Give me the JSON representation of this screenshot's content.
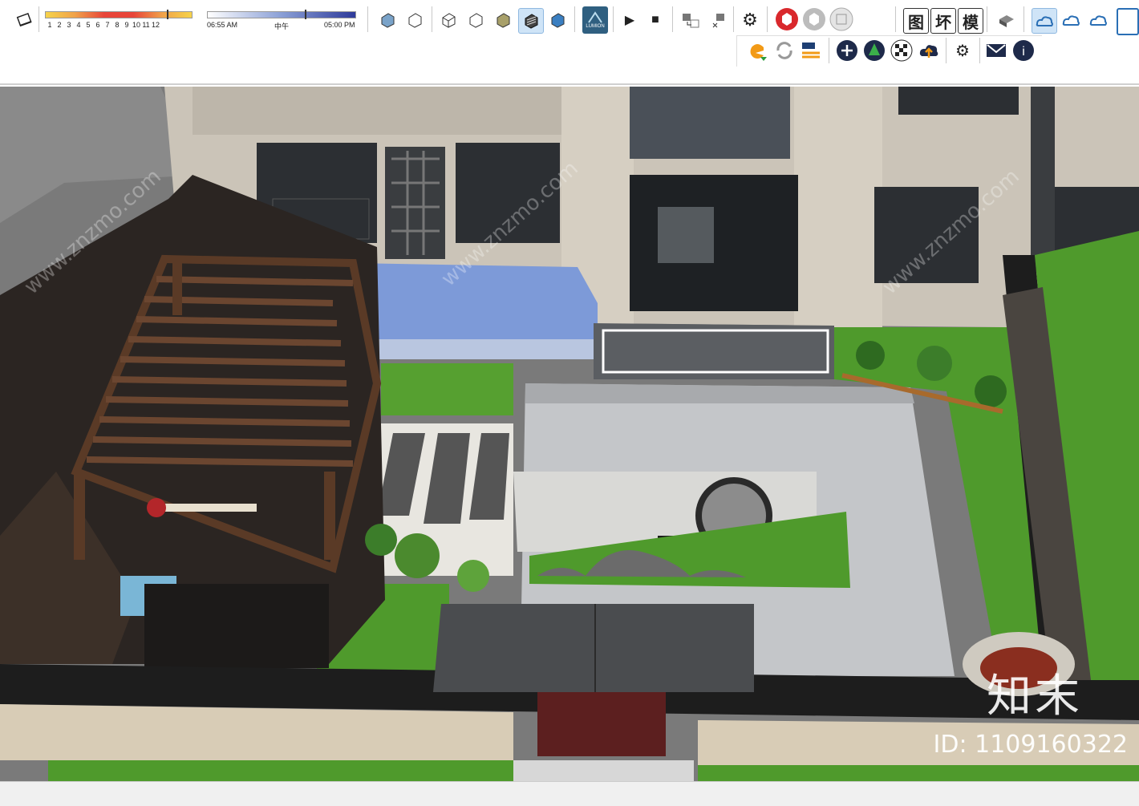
{
  "toolbar": {
    "shadow_months": [
      "1",
      "2",
      "3",
      "4",
      "5",
      "6",
      "7",
      "8",
      "9",
      "10",
      "11",
      "12"
    ],
    "time_start": "06:55 AM",
    "time_mid": "中午",
    "time_end": "05:00 PM",
    "lumion_label": "LUMION",
    "chinese_buttons": [
      "图",
      "坏",
      "模"
    ]
  },
  "watermark": {
    "logo": "知末",
    "id_text": "ID: 1109160322",
    "site": "www.znzmo.com"
  },
  "colors": {
    "sky": "#7d7d7d",
    "grass": "#4f9a2c",
    "paving": "#c4c6c9",
    "pergola": "#5a3a26",
    "building": "#c9c2b6",
    "wall_black": "#1d1d1d"
  }
}
